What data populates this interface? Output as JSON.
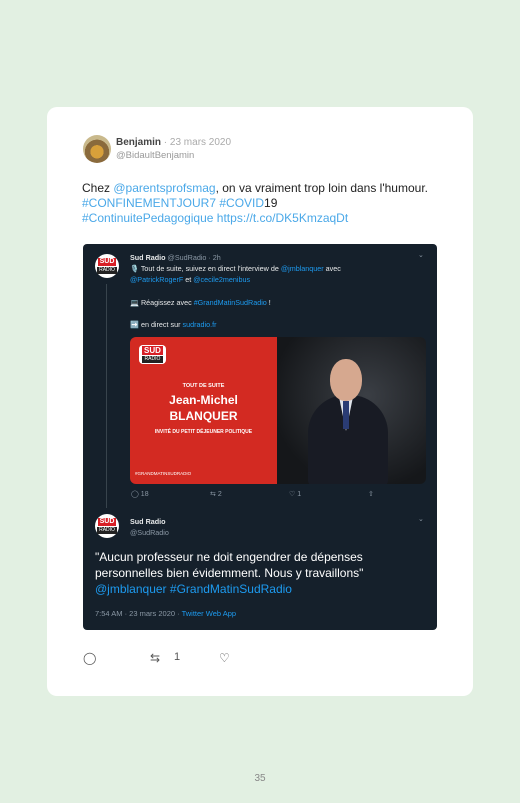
{
  "tweet": {
    "author_name": "Benjamin",
    "date": "· 23 mars 2020",
    "handle": "@BidaultBenjamin",
    "text_prefix": "Chez ",
    "mention": "@parentsprofsmag",
    "text_mid": ", on va vraiment trop loin dans l'humour. ",
    "hashtag1": "#CONFINEMENTJOUR7",
    "hashtag2": "#COVID",
    "text_19": "19",
    "hashtag3": "#ContinuitePedagogique",
    "link": "https://t.co/DK5KmzaqDt",
    "actions": {
      "retweet_count": "1"
    }
  },
  "embedded": {
    "logo_top": "SUD",
    "logo_bottom": "RADIO",
    "quoted": {
      "name": "Sud Radio",
      "handle": "@SudRadio",
      "time": "· 2h",
      "line1_pre": "🎙️ Tout de suite, suivez en direct l'interview de ",
      "line1_mention": "@jmblanquer",
      "line1_post": " avec",
      "line2_mention1": "@PatrickRogerF",
      "line2_mid": " et ",
      "line2_mention2": "@cecile2menibus",
      "line3_pre": "💻 Réagissez avec ",
      "line3_hashtag": "#GrandMatinSudRadio",
      "line3_post": " !",
      "line4_pre": "➡️ en direct sur ",
      "line4_link": "sudradio.fr",
      "media": {
        "logo_top": "SUD",
        "logo_bottom": "RADIO",
        "label_top": "TOUT DE SUITE",
        "name1": "Jean-Michel",
        "name2": "BLANQUER",
        "subtitle": "INVITÉ DU PETIT DÉJEUNER POLITIQUE",
        "hashtag": "#GRANDMATINSUDRADIO"
      },
      "reply_count": "18",
      "retweet_count": "2",
      "like_count": "1"
    },
    "reply": {
      "name": "Sud Radio",
      "handle": "@SudRadio",
      "text": "\"Aucun professeur ne doit engendrer de dépenses personnelles bien évidemment. Nous y travaillons\"",
      "mention": "@jmblanquer",
      "hashtag": "#GrandMatinSudRadio",
      "meta": "7:54 AM · 23 mars 2020 · ",
      "source": "Twitter Web App"
    }
  },
  "page_number": "35"
}
